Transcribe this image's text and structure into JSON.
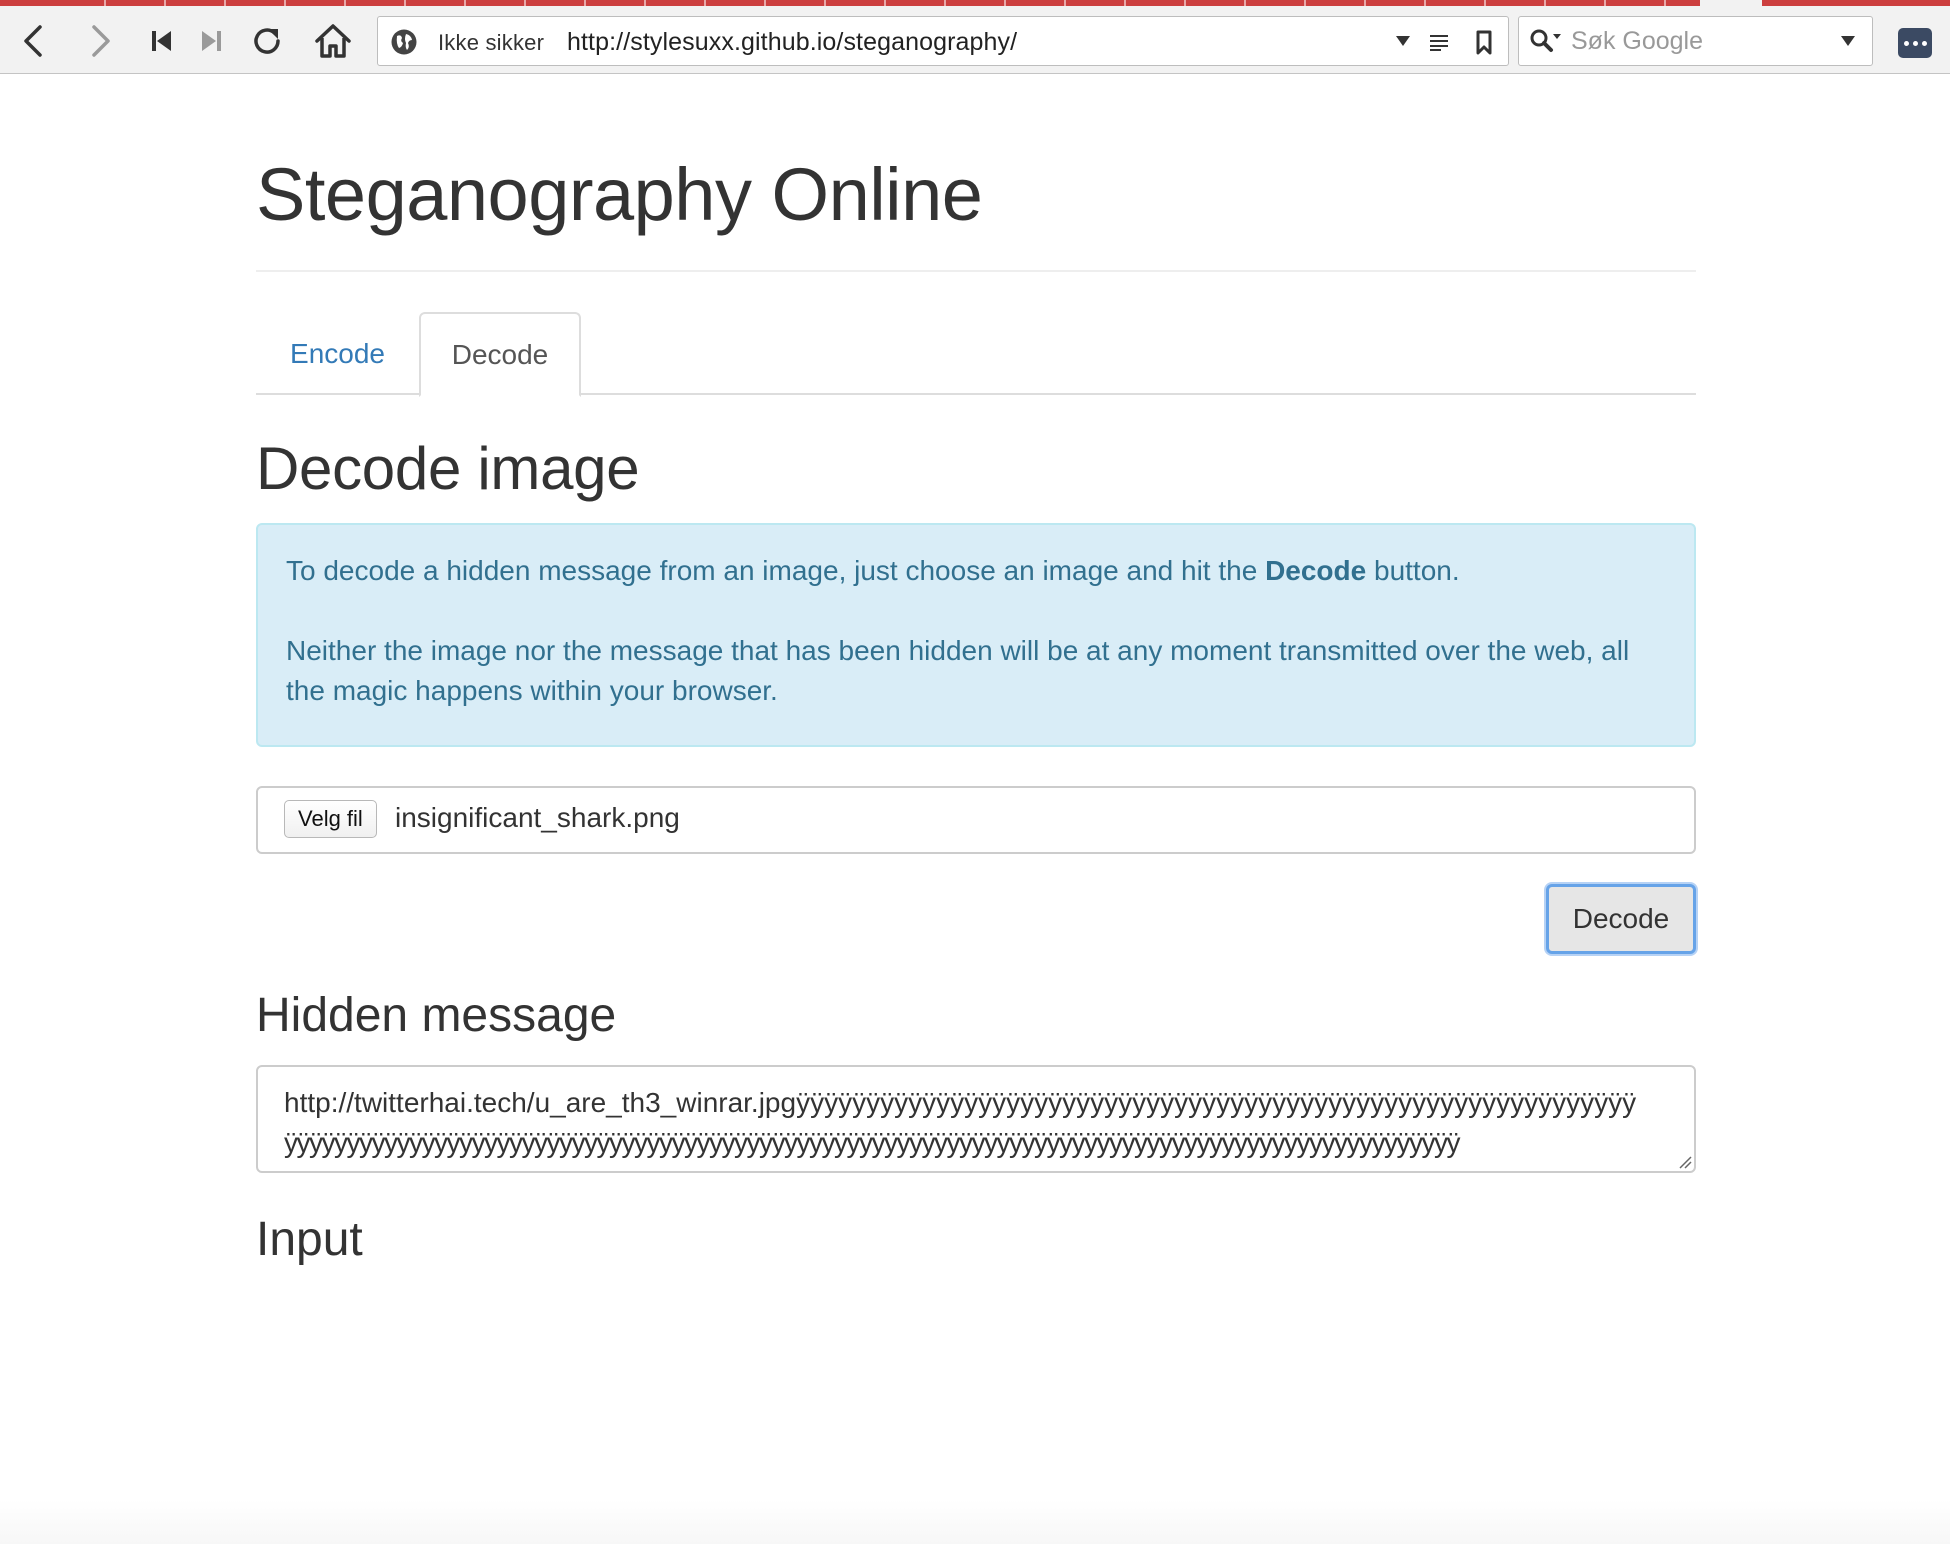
{
  "browser": {
    "security_label": "Ikke sikker",
    "url": "http://stylesuxx.github.io/steganography/",
    "search_placeholder": "Søk Google",
    "icons": {
      "back": "chevron-left-icon",
      "forward": "chevron-right-icon",
      "rewind": "skip-back-icon",
      "fast_forward": "skip-forward-icon",
      "reload": "reload-icon",
      "home": "home-icon",
      "site_info": "globe-icon",
      "url_dropdown": "triangle-down-icon",
      "reader": "reader-view-icon",
      "bookmark": "bookmark-icon",
      "search_engine": "search-icon",
      "search_dropdown": "triangle-down-icon",
      "menu": "vivaldi-menu-icon"
    },
    "accent_color": "#cc3f3f"
  },
  "page": {
    "title": "Steganography Online",
    "tabs": [
      {
        "label": "Encode",
        "active": false
      },
      {
        "label": "Decode",
        "active": true
      }
    ],
    "decode_section": {
      "heading": "Decode image",
      "info_line1_before": "To decode a hidden message from an image, just choose an image and hit the ",
      "info_line1_bold": "Decode",
      "info_line1_after": " button.",
      "info_line2": "Neither the image nor the message that has been hidden will be at any moment transmitted over the web, all the magic happens within your browser.",
      "file_button_label": "Velg fil",
      "file_name": "insignificant_shark.png",
      "decode_button_label": "Decode"
    },
    "hidden_message": {
      "heading": "Hidden message",
      "line1": "http://twitterhai.tech/u_are_th3_winrar.jpgÿÿÿÿÿÿÿÿÿÿÿÿÿÿÿÿÿÿÿÿÿÿÿÿÿÿÿÿÿÿÿÿÿÿÿÿÿÿÿÿÿÿÿÿÿÿÿÿÿÿÿÿÿÿÿÿÿÿÿÿ",
      "line2": "ÿÿÿÿÿÿÿÿÿÿÿÿÿÿÿÿÿÿÿÿÿÿÿÿÿÿÿÿÿÿÿÿÿÿÿÿÿÿÿÿÿÿÿÿÿÿÿÿÿÿÿÿÿÿÿÿÿÿÿÿÿÿÿÿÿÿÿÿÿÿÿÿÿÿÿÿÿÿÿÿÿÿÿÿÿÿÿÿÿÿÿÿÿÿ"
    },
    "input_section": {
      "heading": "Input"
    },
    "colors": {
      "link": "#337ab7",
      "info_bg": "#d9edf7",
      "info_text": "#31708f",
      "focus_ring": "#66a3e8"
    }
  }
}
